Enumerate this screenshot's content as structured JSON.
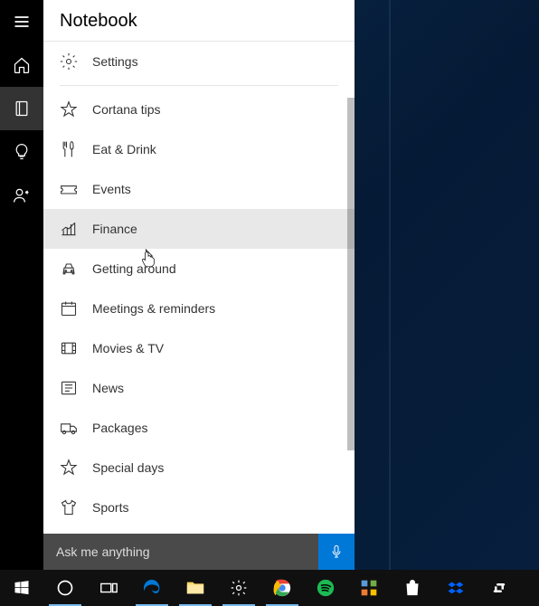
{
  "panel": {
    "title": "Notebook"
  },
  "items": {
    "settings": "Settings",
    "cortana_tips": "Cortana tips",
    "eat_drink": "Eat & Drink",
    "events": "Events",
    "finance": "Finance",
    "getting_around": "Getting around",
    "meetings": "Meetings & reminders",
    "movies_tv": "Movies & TV",
    "news": "News",
    "packages": "Packages",
    "special_days": "Special days",
    "sports": "Sports"
  },
  "search": {
    "placeholder": "Ask me anything"
  }
}
